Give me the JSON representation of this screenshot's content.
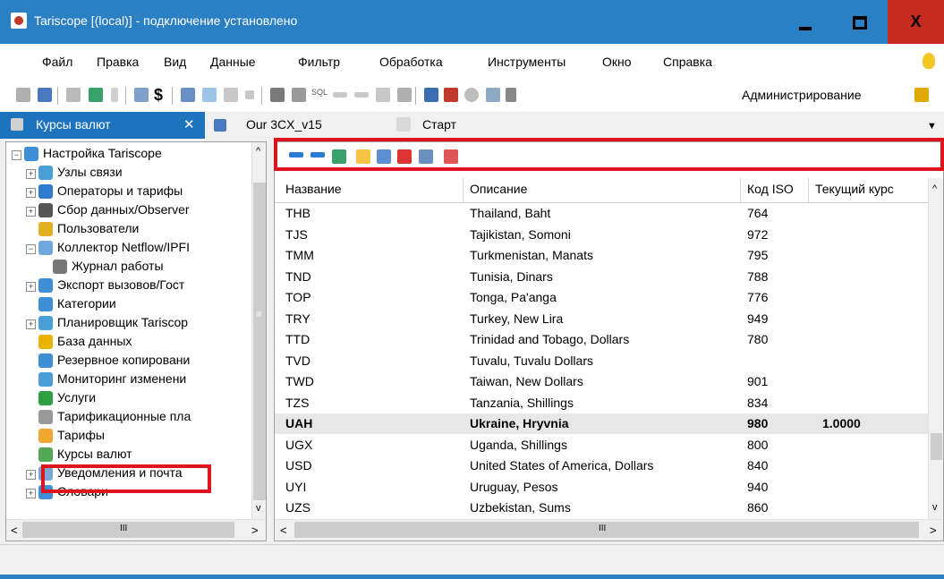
{
  "window": {
    "title": "Tariscope [(local)] - подключение установлено",
    "minimize": "",
    "maximize": "",
    "close": "X"
  },
  "menu": [
    "Файл",
    "Правка",
    "Вид",
    "Данные",
    "Фильтр",
    "Обработка",
    "Инструменты",
    "Окно",
    "Справка"
  ],
  "toolbar": {
    "admin_label": "Администрирование",
    "sql_label": "SQL",
    "dollar_label": "$"
  },
  "tabs": {
    "active": "Курсы валют",
    "active_close": "✕",
    "tab2": "Our 3CX_v15",
    "tab3": "Старт",
    "dropdown": "▼"
  },
  "tree": [
    {
      "label": "Настройка Tariscope",
      "icon": "gears-icon",
      "color": "#3f8fd6"
    },
    {
      "label": "Узлы связи",
      "icon": "network-nodes-icon",
      "color": "#4a9fd8"
    },
    {
      "label": "Операторы и тарифы",
      "icon": "globe-icon",
      "color": "#2e7bcf"
    },
    {
      "label": "Сбор данных/Observer",
      "icon": "observer-icon",
      "color": "#555555"
    },
    {
      "label": "Пользователи",
      "icon": "key-icon",
      "color": "#e0b020"
    },
    {
      "label": "Коллектор Netflow/IPFI",
      "icon": "collector-icon",
      "color": "#6fa8dc"
    },
    {
      "label": "Журнал работы",
      "icon": "journal-icon",
      "color": "#777777"
    },
    {
      "label": "Экспорт вызовов/Гост",
      "icon": "export-icon",
      "color": "#3f8fd6"
    },
    {
      "label": "Категории",
      "icon": "categories-icon",
      "color": "#3f8fd6"
    },
    {
      "label": "Планировщик Tariscop",
      "icon": "scheduler-icon",
      "color": "#4a9fd8"
    },
    {
      "label": "База данных",
      "icon": "database-icon",
      "color": "#e8b400"
    },
    {
      "label": "Резервное копировани",
      "icon": "backup-icon",
      "color": "#3f8fd6"
    },
    {
      "label": "Мониторинг изменени",
      "icon": "monitoring-icon",
      "color": "#4a9fd8"
    },
    {
      "label": "Услуги",
      "icon": "services-icon",
      "color": "#2ea043"
    },
    {
      "label": "Тарификационные пла",
      "icon": "tariff-plans-icon",
      "color": "#999999"
    },
    {
      "label": "Тарифы",
      "icon": "tariffs-icon",
      "color": "#f0a830"
    },
    {
      "label": "Курсы валют",
      "icon": "currency-icon",
      "color": "#55a855"
    },
    {
      "label": "Уведомления и почта",
      "icon": "mail-icon",
      "color": "#7da6d8"
    },
    {
      "label": "Словари",
      "icon": "dictionary-icon",
      "color": "#3f8fd6"
    }
  ],
  "grid": {
    "columns": [
      "Название",
      "Описание",
      "Код ISO",
      "Текущий курс"
    ],
    "rows": [
      {
        "name": "THB",
        "desc": "Thailand, Baht",
        "iso": "764",
        "rate": ""
      },
      {
        "name": "TJS",
        "desc": "Tajikistan, Somoni",
        "iso": "972",
        "rate": ""
      },
      {
        "name": "TMM",
        "desc": "Turkmenistan, Manats",
        "iso": "795",
        "rate": ""
      },
      {
        "name": "TND",
        "desc": "Tunisia, Dinars",
        "iso": "788",
        "rate": ""
      },
      {
        "name": "TOP",
        "desc": "Tonga, Pa'anga",
        "iso": "776",
        "rate": ""
      },
      {
        "name": "TRY",
        "desc": "Turkey, New Lira",
        "iso": "949",
        "rate": ""
      },
      {
        "name": "TTD",
        "desc": "Trinidad and Tobago, Dollars",
        "iso": "780",
        "rate": ""
      },
      {
        "name": "TVD",
        "desc": "Tuvalu, Tuvalu Dollars",
        "iso": "",
        "rate": ""
      },
      {
        "name": "TWD",
        "desc": "Taiwan, New Dollars",
        "iso": "901",
        "rate": ""
      },
      {
        "name": "TZS",
        "desc": "Tanzania, Shillings",
        "iso": "834",
        "rate": ""
      },
      {
        "name": "UAH",
        "desc": "Ukraine, Hryvnia",
        "iso": "980",
        "rate": "1.0000"
      },
      {
        "name": "UGX",
        "desc": "Uganda, Shillings",
        "iso": "800",
        "rate": ""
      },
      {
        "name": "USD",
        "desc": "United States of America, Dollars",
        "iso": "840",
        "rate": ""
      },
      {
        "name": "UYI",
        "desc": "Uruguay, Pesos",
        "iso": "940",
        "rate": ""
      },
      {
        "name": "UZS",
        "desc": "Uzbekistan, Sums",
        "iso": "860",
        "rate": ""
      }
    ]
  },
  "scroll": {
    "left": "<",
    "right": ">",
    "up": "^",
    "down": "v",
    "thumb": "III",
    "grip": "≡"
  }
}
